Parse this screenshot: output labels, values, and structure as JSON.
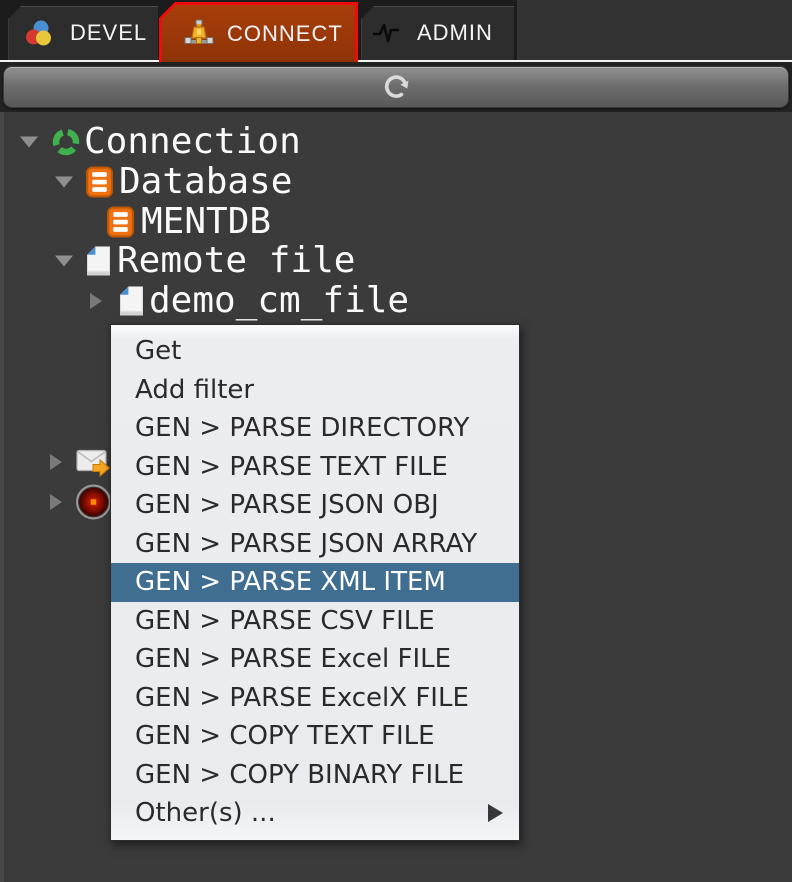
{
  "tabs": {
    "items": [
      {
        "label": "DEVEL",
        "icon": "palette-icon"
      },
      {
        "label": "CONNECT",
        "icon": "network-icon"
      },
      {
        "label": "ADMIN",
        "icon": "pulse-icon"
      }
    ],
    "active": "CONNECT"
  },
  "toolbar": {
    "refresh_icon": "refresh-icon"
  },
  "tree": {
    "items": [
      {
        "label": "Connection",
        "icon": "connection-icon",
        "expander": "down"
      },
      {
        "label": "Database",
        "icon": "database-icon",
        "expander": "down"
      },
      {
        "label": "MENTDB",
        "icon": "database-icon",
        "expander": "none"
      },
      {
        "label": "Remote file",
        "icon": "file-icon",
        "expander": "down"
      },
      {
        "label": "demo_cm_file",
        "icon": "file-icon",
        "expander": "right"
      },
      {
        "label": "",
        "icon": "mail-icon",
        "expander": "right"
      },
      {
        "label": "",
        "icon": "record-icon",
        "expander": "right"
      }
    ]
  },
  "context_menu": {
    "items": [
      {
        "label": "Get"
      },
      {
        "label": "Add filter"
      },
      {
        "label": "GEN > PARSE DIRECTORY"
      },
      {
        "label": "GEN > PARSE TEXT FILE"
      },
      {
        "label": "GEN > PARSE JSON OBJ"
      },
      {
        "label": "GEN > PARSE JSON ARRAY"
      },
      {
        "label": "GEN > PARSE XML ITEM",
        "highlighted": true
      },
      {
        "label": "GEN > PARSE CSV FILE"
      },
      {
        "label": "GEN > PARSE Excel FILE"
      },
      {
        "label": "GEN > PARSE ExcelX FILE"
      },
      {
        "label": "GEN > COPY TEXT FILE"
      },
      {
        "label": "GEN > COPY BINARY FILE"
      },
      {
        "label": "Other(s) ...",
        "submenu": true
      }
    ]
  },
  "colors": {
    "window_background": "#3b3b3b",
    "tabbar_background": "#1c1c1c",
    "active_tab": "#9a3708",
    "active_tab_border": "#ee0c0c",
    "tab_text": "#f4f4f4",
    "menu_background": "#eceef1",
    "menu_text": "#2a2a2a",
    "menu_highlight": "#3f6e90",
    "menu_highlight_text": "#ffffff",
    "tree_text": "#fafafa",
    "database_icon_orange": "#ee7112",
    "connection_icon_green": "#3fb24d",
    "file_fold_blue": "#4a8fd3"
  }
}
